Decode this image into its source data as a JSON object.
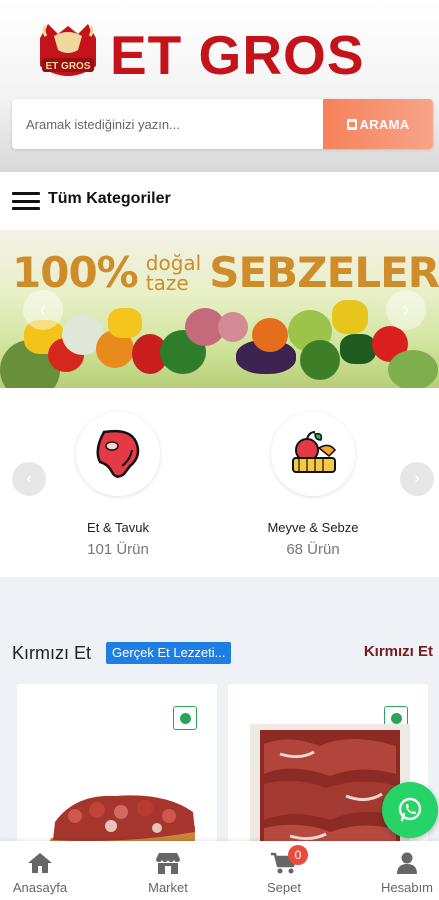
{
  "brand": {
    "name": "ET GROS",
    "badge_text": "ET GROS"
  },
  "search": {
    "placeholder": "Aramak istediğinizi yazın...",
    "button_label": "ARAMA"
  },
  "categories_bar": {
    "label": "Tüm Kategoriler"
  },
  "banner": {
    "big_text": "100%",
    "small_top": "doğal",
    "small_bottom": "taze",
    "headline": "SEBZELER"
  },
  "category_cards": [
    {
      "name": "Et & Tavuk",
      "count": "101 Ürün",
      "icon": "steak-icon"
    },
    {
      "name": "Meyve & Sebze",
      "count": "68 Ürün",
      "icon": "fruit-basket-icon"
    }
  ],
  "product_section": {
    "title": "Kırmızı Et",
    "tag": "Gerçek Et Lezzeti...",
    "link": "Kırmızı Et"
  },
  "bottom_nav": [
    {
      "label": "Anasayfa",
      "icon": "home-icon"
    },
    {
      "label": "Market",
      "icon": "store-icon"
    },
    {
      "label": "Sepet",
      "icon": "cart-icon",
      "badge": "0"
    },
    {
      "label": "Hesabım",
      "icon": "user-icon"
    }
  ],
  "colors": {
    "brand_red": "#c4131a",
    "search_button": "#f5825b",
    "tag_blue": "#1e7ee4",
    "whatsapp_green": "#25d366"
  }
}
